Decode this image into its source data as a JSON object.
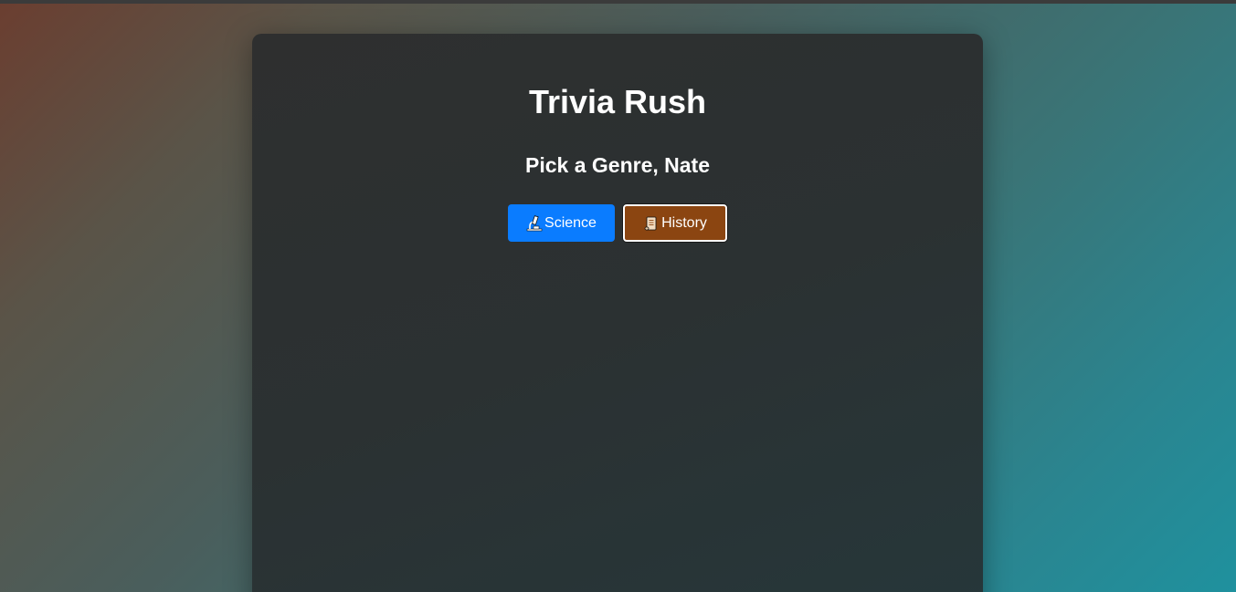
{
  "app": {
    "title": "Trivia Rush",
    "prompt": "Pick a Genre, Nate"
  },
  "genres": [
    {
      "label": "Science",
      "icon": "microscope-icon",
      "color": "#0a7cff",
      "selected": false
    },
    {
      "label": "History",
      "icon": "scroll-icon",
      "color": "#8b4511",
      "selected": true
    }
  ],
  "theme": {
    "card_background": "#2b3132",
    "text_color": "#ffffff"
  }
}
